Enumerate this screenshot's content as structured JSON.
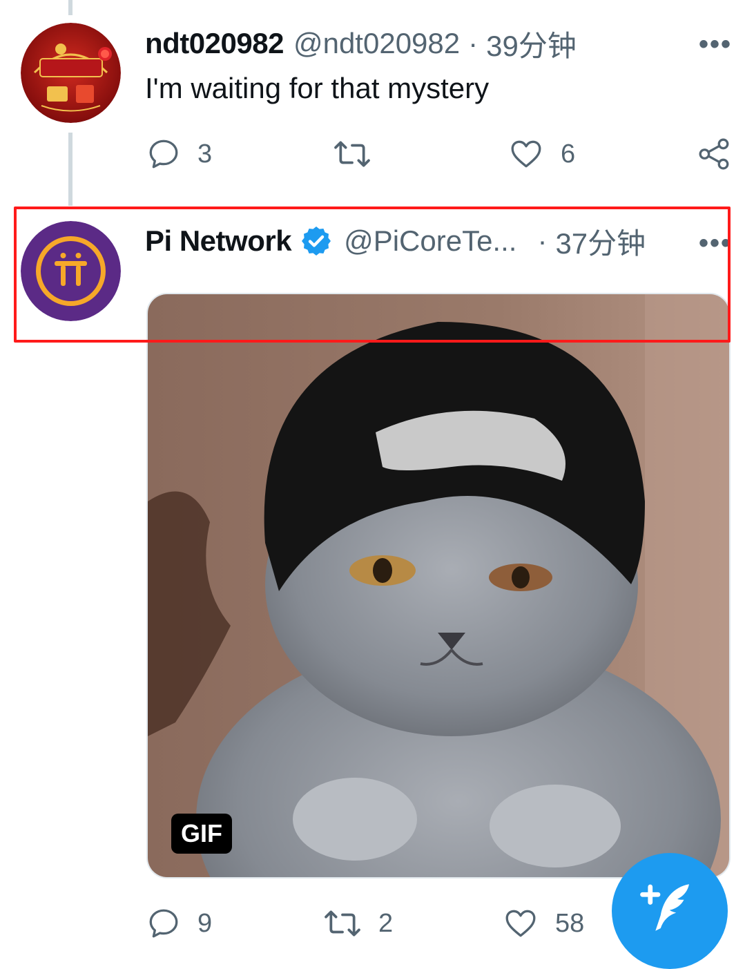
{
  "tweet_reply": {
    "display_name": "ndt020982",
    "handle": "@ndt020982",
    "separator": "·",
    "time": "39分钟",
    "more": "•••",
    "text": "I'm waiting for that mystery",
    "reply_count": "3",
    "retweet_count": "",
    "like_count": "6",
    "avatar_icon": "pi-network-vietnam-avatar"
  },
  "tweet_main": {
    "display_name": "Pi Network",
    "verified_icon": "verified-badge-icon",
    "handle": "@PiCoreTe...",
    "separator": "·",
    "time": "37分钟",
    "more": "•••",
    "media_badge": "GIF",
    "media_description_icon": "cat-with-beanie-gif",
    "reply_count": "9",
    "retweet_count": "2",
    "like_count": "58",
    "avatar_icon": "pi-logo-avatar"
  },
  "colors": {
    "accent": "#1d9bf0",
    "muted_text": "#536471",
    "highlight": "#ff1a1a",
    "pi_purple": "#5b2a86",
    "pi_gold": "#f7a829"
  },
  "compose_button_icon": "compose-feather-plus-icon"
}
